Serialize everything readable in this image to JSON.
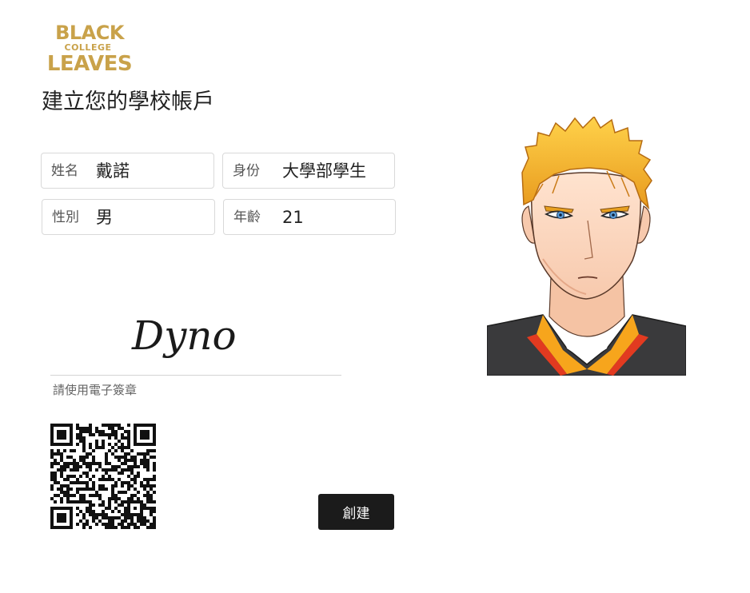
{
  "logo": {
    "line1": "BLACK",
    "line2": "COLLEGE",
    "line3": "LEAVES",
    "color": "#c9a24a"
  },
  "page_title": "建立您的學校帳戶",
  "form": {
    "name": {
      "label": "姓名",
      "value": "戴諾"
    },
    "status": {
      "label": "身份",
      "value": "大學部學生"
    },
    "gender": {
      "label": "性別",
      "value": "男"
    },
    "age": {
      "label": "年齡",
      "value": "21"
    }
  },
  "signature": {
    "text": "Dyno",
    "caption": "請使用電子簽章"
  },
  "qr_code": {
    "icon": "qr-code-icon"
  },
  "buttons": {
    "create_label": "創建",
    "create_color": "#1b1b1b"
  },
  "avatar": {
    "icon": "anime-student-portrait",
    "hair_color": "#f2b533"
  }
}
